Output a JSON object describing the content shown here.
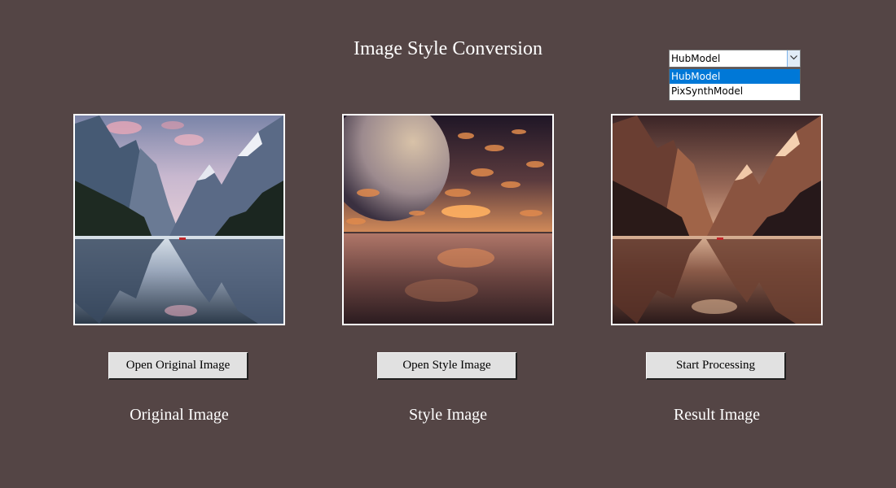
{
  "window": {
    "title": "Image Style Conversion"
  },
  "model_select": {
    "value": "HubModel",
    "options": [
      "HubModel",
      "PixSynthModel"
    ],
    "selected_index": 0
  },
  "buttons": {
    "open_original": "Open Original Image",
    "open_style": "Open Style Image",
    "start_processing": "Start Processing"
  },
  "captions": {
    "original": "Original Image",
    "style": "Style Image",
    "result": "Result Image"
  },
  "colors": {
    "background": "#544545",
    "panel_border": "#ffffff",
    "dropdown_selected": "#0078d7"
  }
}
